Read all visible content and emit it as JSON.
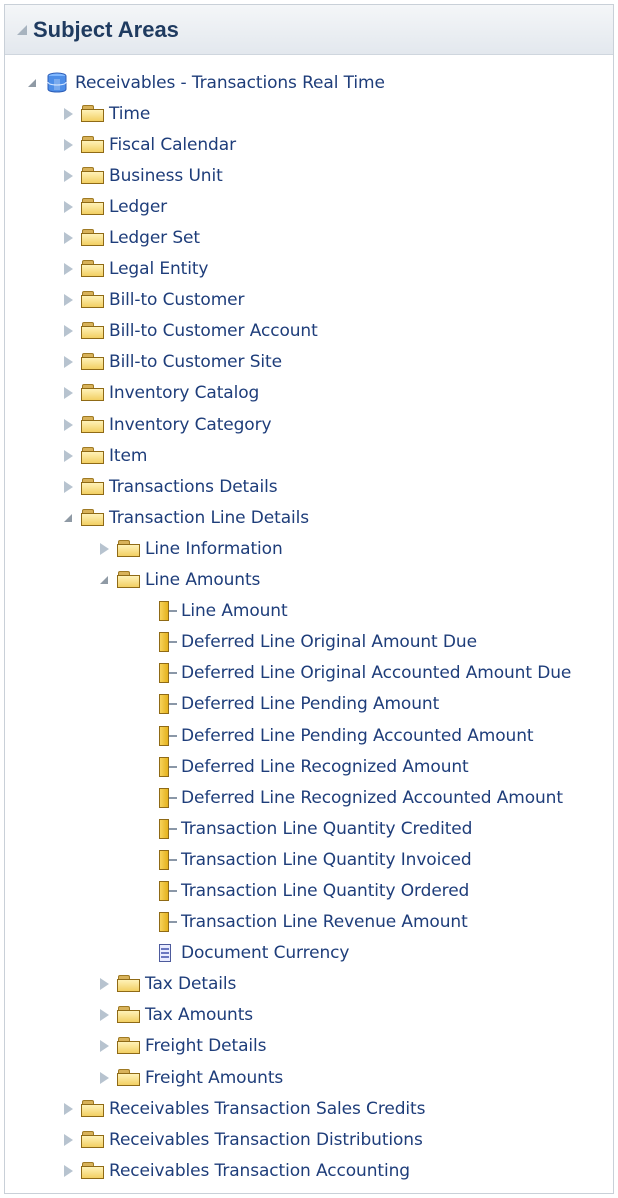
{
  "header": {
    "title": "Subject Areas"
  },
  "tree": {
    "root": {
      "label": "Receivables - Transactions Real Time",
      "expanded": true,
      "icon": "database-icon"
    },
    "level1_folders": [
      {
        "label": "Time",
        "expanded": false
      },
      {
        "label": "Fiscal Calendar",
        "expanded": false
      },
      {
        "label": "Business Unit",
        "expanded": false
      },
      {
        "label": "Ledger",
        "expanded": false
      },
      {
        "label": "Ledger Set",
        "expanded": false
      },
      {
        "label": "Legal Entity",
        "expanded": false
      },
      {
        "label": "Bill-to Customer",
        "expanded": false
      },
      {
        "label": "Bill-to Customer Account",
        "expanded": false
      },
      {
        "label": "Bill-to Customer Site",
        "expanded": false
      },
      {
        "label": "Inventory Catalog",
        "expanded": false
      },
      {
        "label": "Inventory Category",
        "expanded": false
      },
      {
        "label": "Item",
        "expanded": false
      },
      {
        "label": "Transactions Details",
        "expanded": false
      },
      {
        "label": "Transaction Line Details",
        "expanded": true
      }
    ],
    "transaction_line_details_children": [
      {
        "label": "Line Information",
        "expanded": false
      },
      {
        "label": "Line Amounts",
        "expanded": true
      }
    ],
    "line_amounts_children": [
      {
        "label": "Line Amount",
        "icon": "measure-icon"
      },
      {
        "label": "Deferred Line Original Amount Due",
        "icon": "measure-icon"
      },
      {
        "label": "Deferred Line Original Accounted Amount Due",
        "icon": "measure-icon"
      },
      {
        "label": "Deferred Line Pending Amount",
        "icon": "measure-icon"
      },
      {
        "label": "Deferred Line Pending Accounted Amount",
        "icon": "measure-icon"
      },
      {
        "label": "Deferred Line Recognized Amount",
        "icon": "measure-icon"
      },
      {
        "label": "Deferred Line Recognized Accounted Amount",
        "icon": "measure-icon"
      },
      {
        "label": "Transaction Line Quantity Credited",
        "icon": "measure-icon"
      },
      {
        "label": "Transaction Line Quantity Invoiced",
        "icon": "measure-icon"
      },
      {
        "label": "Transaction Line Quantity Ordered",
        "icon": "measure-icon"
      },
      {
        "label": "Transaction Line Revenue Amount",
        "icon": "measure-icon"
      },
      {
        "label": "Document Currency",
        "icon": "attribute-icon"
      }
    ],
    "transaction_line_details_more": [
      {
        "label": "Tax Details",
        "expanded": false
      },
      {
        "label": "Tax Amounts",
        "expanded": false
      },
      {
        "label": "Freight Details",
        "expanded": false
      },
      {
        "label": "Freight Amounts",
        "expanded": false
      }
    ],
    "level1_more": [
      {
        "label": "Receivables Transaction Sales Credits",
        "expanded": false
      },
      {
        "label": "Receivables Transaction Distributions",
        "expanded": false
      },
      {
        "label": "Receivables Transaction Accounting",
        "expanded": false
      }
    ]
  }
}
